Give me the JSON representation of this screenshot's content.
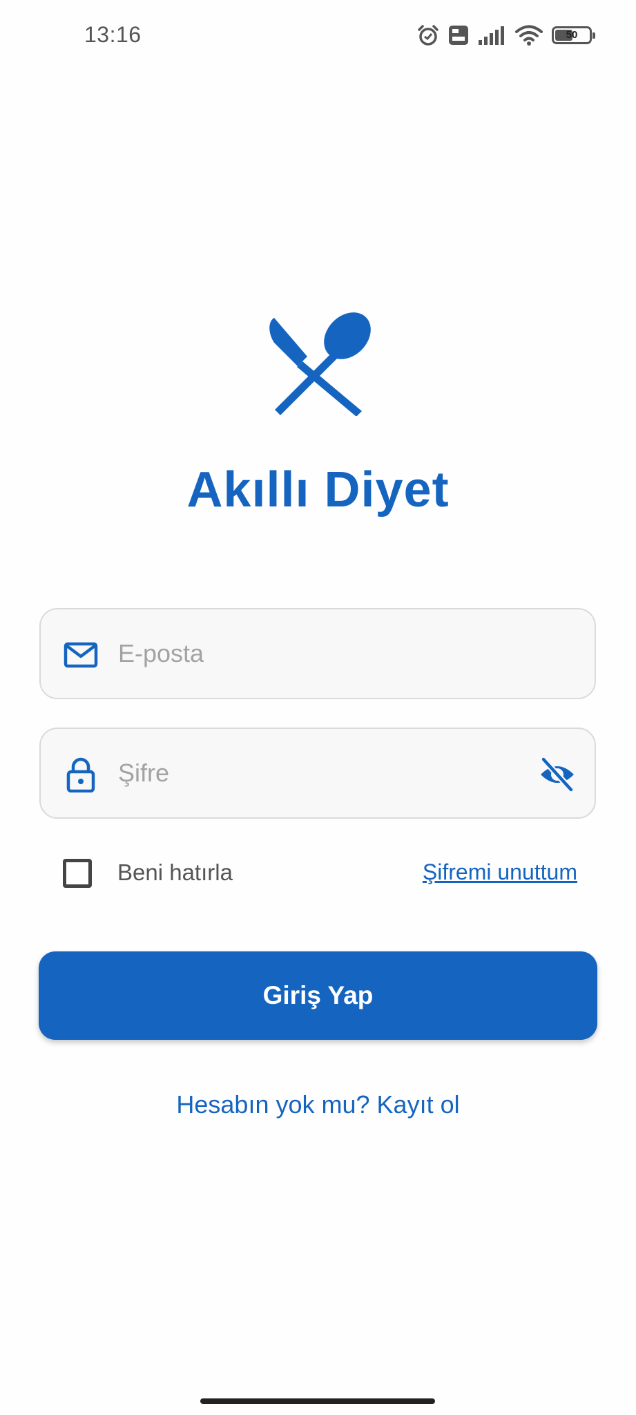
{
  "status_bar": {
    "time": "13:16",
    "icons": [
      "alarm-icon",
      "volte-icon",
      "signal-icon",
      "wifi-icon",
      "battery-icon"
    ],
    "battery_level": "50"
  },
  "app": {
    "title": "Akıllı Diyet",
    "logo_icon": "fork-knife-spoon-icon",
    "brand_color": "#1565c0"
  },
  "form": {
    "email": {
      "placeholder": "E-posta",
      "value": "",
      "icon": "mail-icon"
    },
    "password": {
      "placeholder": "Şifre",
      "value": "",
      "icon": "lock-icon",
      "toggle_icon": "eye-off-icon"
    },
    "remember_label": "Beni hatırla",
    "remember_checked": false,
    "forgot_link": "Şifremi unuttum",
    "login_button": "Giriş Yap",
    "register_link": "Hesabın yok mu? Kayıt ol"
  }
}
